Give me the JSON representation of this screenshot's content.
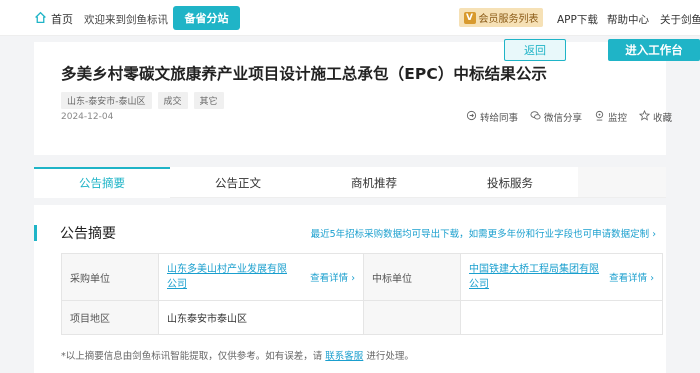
{
  "topbar": {
    "home_label": "首页",
    "welcome": "欢迎来到剑鱼标讯",
    "branch_button": "备省分站",
    "member_button": "会员服务列表",
    "member_badge": "V",
    "app_download": "APP下载",
    "help_center": "帮助中心",
    "about": "关于剑鱼"
  },
  "header": {
    "title": "多美乡村零碳文旅康养产业项目设计施工总承包（EPC）中标结果公示",
    "tags": [
      "山东-泰安市-泰山区",
      "成交",
      "其它"
    ],
    "date": "2024-12-04",
    "back_button": "返回",
    "workbench_button": "进入工作台",
    "actions": {
      "forward": "转给同事",
      "wechat_share": "微信分享",
      "monitor": "监控",
      "favorite": "收藏"
    }
  },
  "tabs": [
    "公告摘要",
    "公告正文",
    "商机推荐",
    "投标服务"
  ],
  "summary": {
    "title": "公告摘要",
    "note": "最近5年招标采购数据均可导出下载，如需更多年份和行业字段也可申请数据定制",
    "rows": {
      "purchaser_label": "采购单位",
      "purchaser_value": "山东多美山村产业发展有限公司",
      "winner_label": "中标单位",
      "winner_value": "中国铁建大桥工程局集团有限公司",
      "detail_link": "查看详情",
      "region_label": "项目地区",
      "region_value": "山东泰安市泰山区"
    },
    "footnote_prefix": "*以上摘要信息由剑鱼标讯智能提取，仅供参考。如有误差，请",
    "footnote_link": "联系客服",
    "footnote_suffix": "进行处理。"
  },
  "colors": {
    "accent": "#1fb4c7",
    "link": "#1a9fce",
    "member_bg": "#f6e1b6"
  }
}
